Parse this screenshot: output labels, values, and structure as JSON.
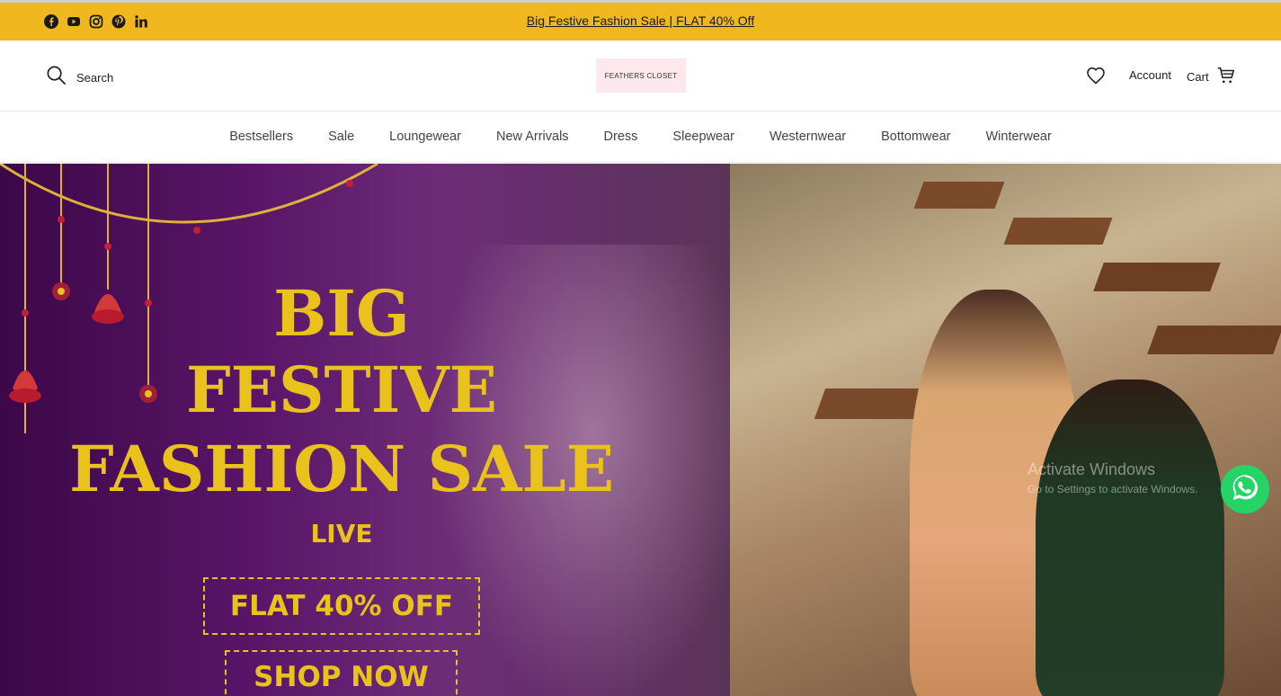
{
  "announcement": {
    "text": "Big Festive Fashion Sale | FLAT 40% Off",
    "background": "#f0b81e"
  },
  "social": [
    {
      "icon": "facebook-icon"
    },
    {
      "icon": "youtube-icon"
    },
    {
      "icon": "instagram-icon"
    },
    {
      "icon": "pinterest-icon"
    },
    {
      "icon": "linkedin-icon"
    }
  ],
  "header": {
    "search_label": "Search",
    "logo_text": "FEATHERS CLOSET",
    "account_label": "Account",
    "cart_label": "Cart"
  },
  "nav": {
    "items": [
      "Bestsellers",
      "Sale",
      "Loungewear",
      "New Arrivals",
      "Dress",
      "Sleepwear",
      "Westernwear",
      "Bottomwear",
      "Winterwear"
    ]
  },
  "hero": {
    "line1": "BIG",
    "line2": "FESTIVE",
    "line3": "FASHION SALE",
    "live": "LIVE",
    "offer": "FLAT 40% OFF",
    "cta": "SHOP NOW",
    "accent": "#e9c21c"
  },
  "overlay": {
    "watermark_title": "Activate Windows",
    "watermark_sub": "Go to Settings to activate Windows."
  }
}
